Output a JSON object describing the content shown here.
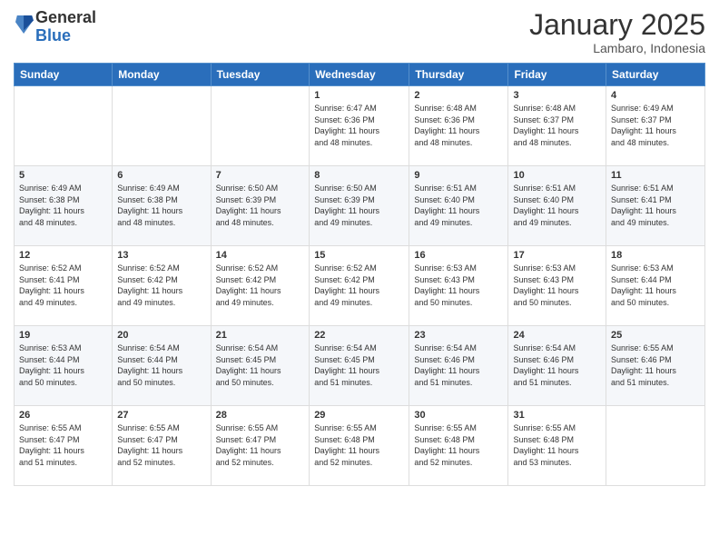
{
  "header": {
    "logo_general": "General",
    "logo_blue": "Blue",
    "month_title": "January 2025",
    "location": "Lambaro, Indonesia"
  },
  "days_of_week": [
    "Sunday",
    "Monday",
    "Tuesday",
    "Wednesday",
    "Thursday",
    "Friday",
    "Saturday"
  ],
  "weeks": [
    [
      {
        "day": "",
        "info": ""
      },
      {
        "day": "",
        "info": ""
      },
      {
        "day": "",
        "info": ""
      },
      {
        "day": "1",
        "info": "Sunrise: 6:47 AM\nSunset: 6:36 PM\nDaylight: 11 hours\nand 48 minutes."
      },
      {
        "day": "2",
        "info": "Sunrise: 6:48 AM\nSunset: 6:36 PM\nDaylight: 11 hours\nand 48 minutes."
      },
      {
        "day": "3",
        "info": "Sunrise: 6:48 AM\nSunset: 6:37 PM\nDaylight: 11 hours\nand 48 minutes."
      },
      {
        "day": "4",
        "info": "Sunrise: 6:49 AM\nSunset: 6:37 PM\nDaylight: 11 hours\nand 48 minutes."
      }
    ],
    [
      {
        "day": "5",
        "info": "Sunrise: 6:49 AM\nSunset: 6:38 PM\nDaylight: 11 hours\nand 48 minutes."
      },
      {
        "day": "6",
        "info": "Sunrise: 6:49 AM\nSunset: 6:38 PM\nDaylight: 11 hours\nand 48 minutes."
      },
      {
        "day": "7",
        "info": "Sunrise: 6:50 AM\nSunset: 6:39 PM\nDaylight: 11 hours\nand 48 minutes."
      },
      {
        "day": "8",
        "info": "Sunrise: 6:50 AM\nSunset: 6:39 PM\nDaylight: 11 hours\nand 49 minutes."
      },
      {
        "day": "9",
        "info": "Sunrise: 6:51 AM\nSunset: 6:40 PM\nDaylight: 11 hours\nand 49 minutes."
      },
      {
        "day": "10",
        "info": "Sunrise: 6:51 AM\nSunset: 6:40 PM\nDaylight: 11 hours\nand 49 minutes."
      },
      {
        "day": "11",
        "info": "Sunrise: 6:51 AM\nSunset: 6:41 PM\nDaylight: 11 hours\nand 49 minutes."
      }
    ],
    [
      {
        "day": "12",
        "info": "Sunrise: 6:52 AM\nSunset: 6:41 PM\nDaylight: 11 hours\nand 49 minutes."
      },
      {
        "day": "13",
        "info": "Sunrise: 6:52 AM\nSunset: 6:42 PM\nDaylight: 11 hours\nand 49 minutes."
      },
      {
        "day": "14",
        "info": "Sunrise: 6:52 AM\nSunset: 6:42 PM\nDaylight: 11 hours\nand 49 minutes."
      },
      {
        "day": "15",
        "info": "Sunrise: 6:52 AM\nSunset: 6:42 PM\nDaylight: 11 hours\nand 49 minutes."
      },
      {
        "day": "16",
        "info": "Sunrise: 6:53 AM\nSunset: 6:43 PM\nDaylight: 11 hours\nand 50 minutes."
      },
      {
        "day": "17",
        "info": "Sunrise: 6:53 AM\nSunset: 6:43 PM\nDaylight: 11 hours\nand 50 minutes."
      },
      {
        "day": "18",
        "info": "Sunrise: 6:53 AM\nSunset: 6:44 PM\nDaylight: 11 hours\nand 50 minutes."
      }
    ],
    [
      {
        "day": "19",
        "info": "Sunrise: 6:53 AM\nSunset: 6:44 PM\nDaylight: 11 hours\nand 50 minutes."
      },
      {
        "day": "20",
        "info": "Sunrise: 6:54 AM\nSunset: 6:44 PM\nDaylight: 11 hours\nand 50 minutes."
      },
      {
        "day": "21",
        "info": "Sunrise: 6:54 AM\nSunset: 6:45 PM\nDaylight: 11 hours\nand 50 minutes."
      },
      {
        "day": "22",
        "info": "Sunrise: 6:54 AM\nSunset: 6:45 PM\nDaylight: 11 hours\nand 51 minutes."
      },
      {
        "day": "23",
        "info": "Sunrise: 6:54 AM\nSunset: 6:46 PM\nDaylight: 11 hours\nand 51 minutes."
      },
      {
        "day": "24",
        "info": "Sunrise: 6:54 AM\nSunset: 6:46 PM\nDaylight: 11 hours\nand 51 minutes."
      },
      {
        "day": "25",
        "info": "Sunrise: 6:55 AM\nSunset: 6:46 PM\nDaylight: 11 hours\nand 51 minutes."
      }
    ],
    [
      {
        "day": "26",
        "info": "Sunrise: 6:55 AM\nSunset: 6:47 PM\nDaylight: 11 hours\nand 51 minutes."
      },
      {
        "day": "27",
        "info": "Sunrise: 6:55 AM\nSunset: 6:47 PM\nDaylight: 11 hours\nand 52 minutes."
      },
      {
        "day": "28",
        "info": "Sunrise: 6:55 AM\nSunset: 6:47 PM\nDaylight: 11 hours\nand 52 minutes."
      },
      {
        "day": "29",
        "info": "Sunrise: 6:55 AM\nSunset: 6:48 PM\nDaylight: 11 hours\nand 52 minutes."
      },
      {
        "day": "30",
        "info": "Sunrise: 6:55 AM\nSunset: 6:48 PM\nDaylight: 11 hours\nand 52 minutes."
      },
      {
        "day": "31",
        "info": "Sunrise: 6:55 AM\nSunset: 6:48 PM\nDaylight: 11 hours\nand 53 minutes."
      },
      {
        "day": "",
        "info": ""
      }
    ]
  ]
}
